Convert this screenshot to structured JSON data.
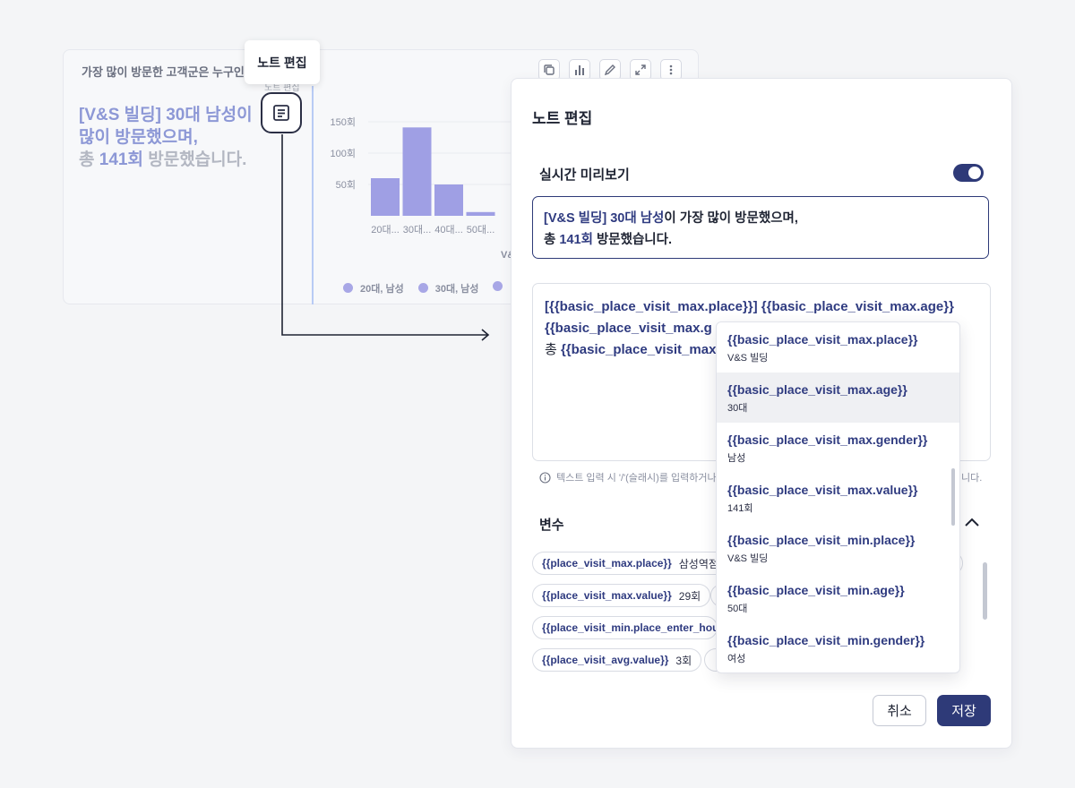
{
  "card": {
    "title": "가장 많이 방문한 고객군은 누구인",
    "note_line1_hl": "[V&S 빌딩] 30대 남성이",
    "note_line2_hl": "많이 방문했으며,",
    "note_line3_pre": "총 ",
    "note_line3_hl": "141회",
    "note_line3_post": " 방문했습니다.",
    "faint_label": "노트 편집",
    "toolbar_icons": [
      "copy-icon",
      "bar-chart-icon",
      "pencil-icon",
      "expand-icon",
      "more-vertical-icon"
    ]
  },
  "tooltip": {
    "label": "노트 편집"
  },
  "chart_data": {
    "type": "bar",
    "categories": [
      "20대...",
      "30대...",
      "40대...",
      "50대..."
    ],
    "values": [
      60,
      141,
      50,
      6
    ],
    "ylim": [
      0,
      160
    ],
    "yticks": [
      "150회",
      "100회",
      "50회"
    ],
    "xlabel": "V&",
    "legend": [
      "20대, 남성",
      "30대, 남성"
    ],
    "bar_color": "#9f9fe4"
  },
  "modal": {
    "title": "노트 편집",
    "preview_label": "실시간 미리보기",
    "preview_enabled": true,
    "preview_text": {
      "hl1": "[V&S 빌딩] 30대 남성",
      "t1": "이 가장 많이 방문했으며,",
      "t2": "총 ",
      "hl2": "141회",
      "t3": " 방문했습니다."
    },
    "editor": {
      "line1": "[{{basic_place_visit_max.place}}] {{basic_place_visit_max.age}}",
      "line2": "{{basic_place_visit_max.g",
      "line3_pre": "총 ",
      "line3_var": "{{basic_place_visit_max"
    },
    "hint": "텍스트 입력 시 '/'(슬래시)를 입력하거나",
    "hint_tail": "니다.",
    "variables_title": "변수",
    "chips": [
      {
        "key": "{{place_visit_max.place}}",
        "value": "삼성역점"
      },
      {
        "key": "{{place_visit_max.value}}",
        "value": "29회"
      },
      {
        "key": "{{place_visit_min.place_enter_hour}}",
        "value": ""
      },
      {
        "key": "{{place_visit_avg.value}}",
        "value": "3회"
      }
    ],
    "cancel_label": "취소",
    "save_label": "저장",
    "accent_color": "#2e3a78"
  },
  "dropdown": {
    "items": [
      {
        "key": "{{basic_place_visit_max.place}}",
        "value": "V&S 빌딩"
      },
      {
        "key": "{{basic_place_visit_max.age}}",
        "value": "30대",
        "active": true
      },
      {
        "key": "{{basic_place_visit_max.gender}}",
        "value": "남성"
      },
      {
        "key": "{{basic_place_visit_max.value}}",
        "value": "141회"
      },
      {
        "key": "{{basic_place_visit_min.place}}",
        "value": "V&S 빌딩"
      },
      {
        "key": "{{basic_place_visit_min.age}}",
        "value": "50대"
      },
      {
        "key": "{{basic_place_visit_min.gender}}",
        "value": "여성"
      }
    ]
  }
}
